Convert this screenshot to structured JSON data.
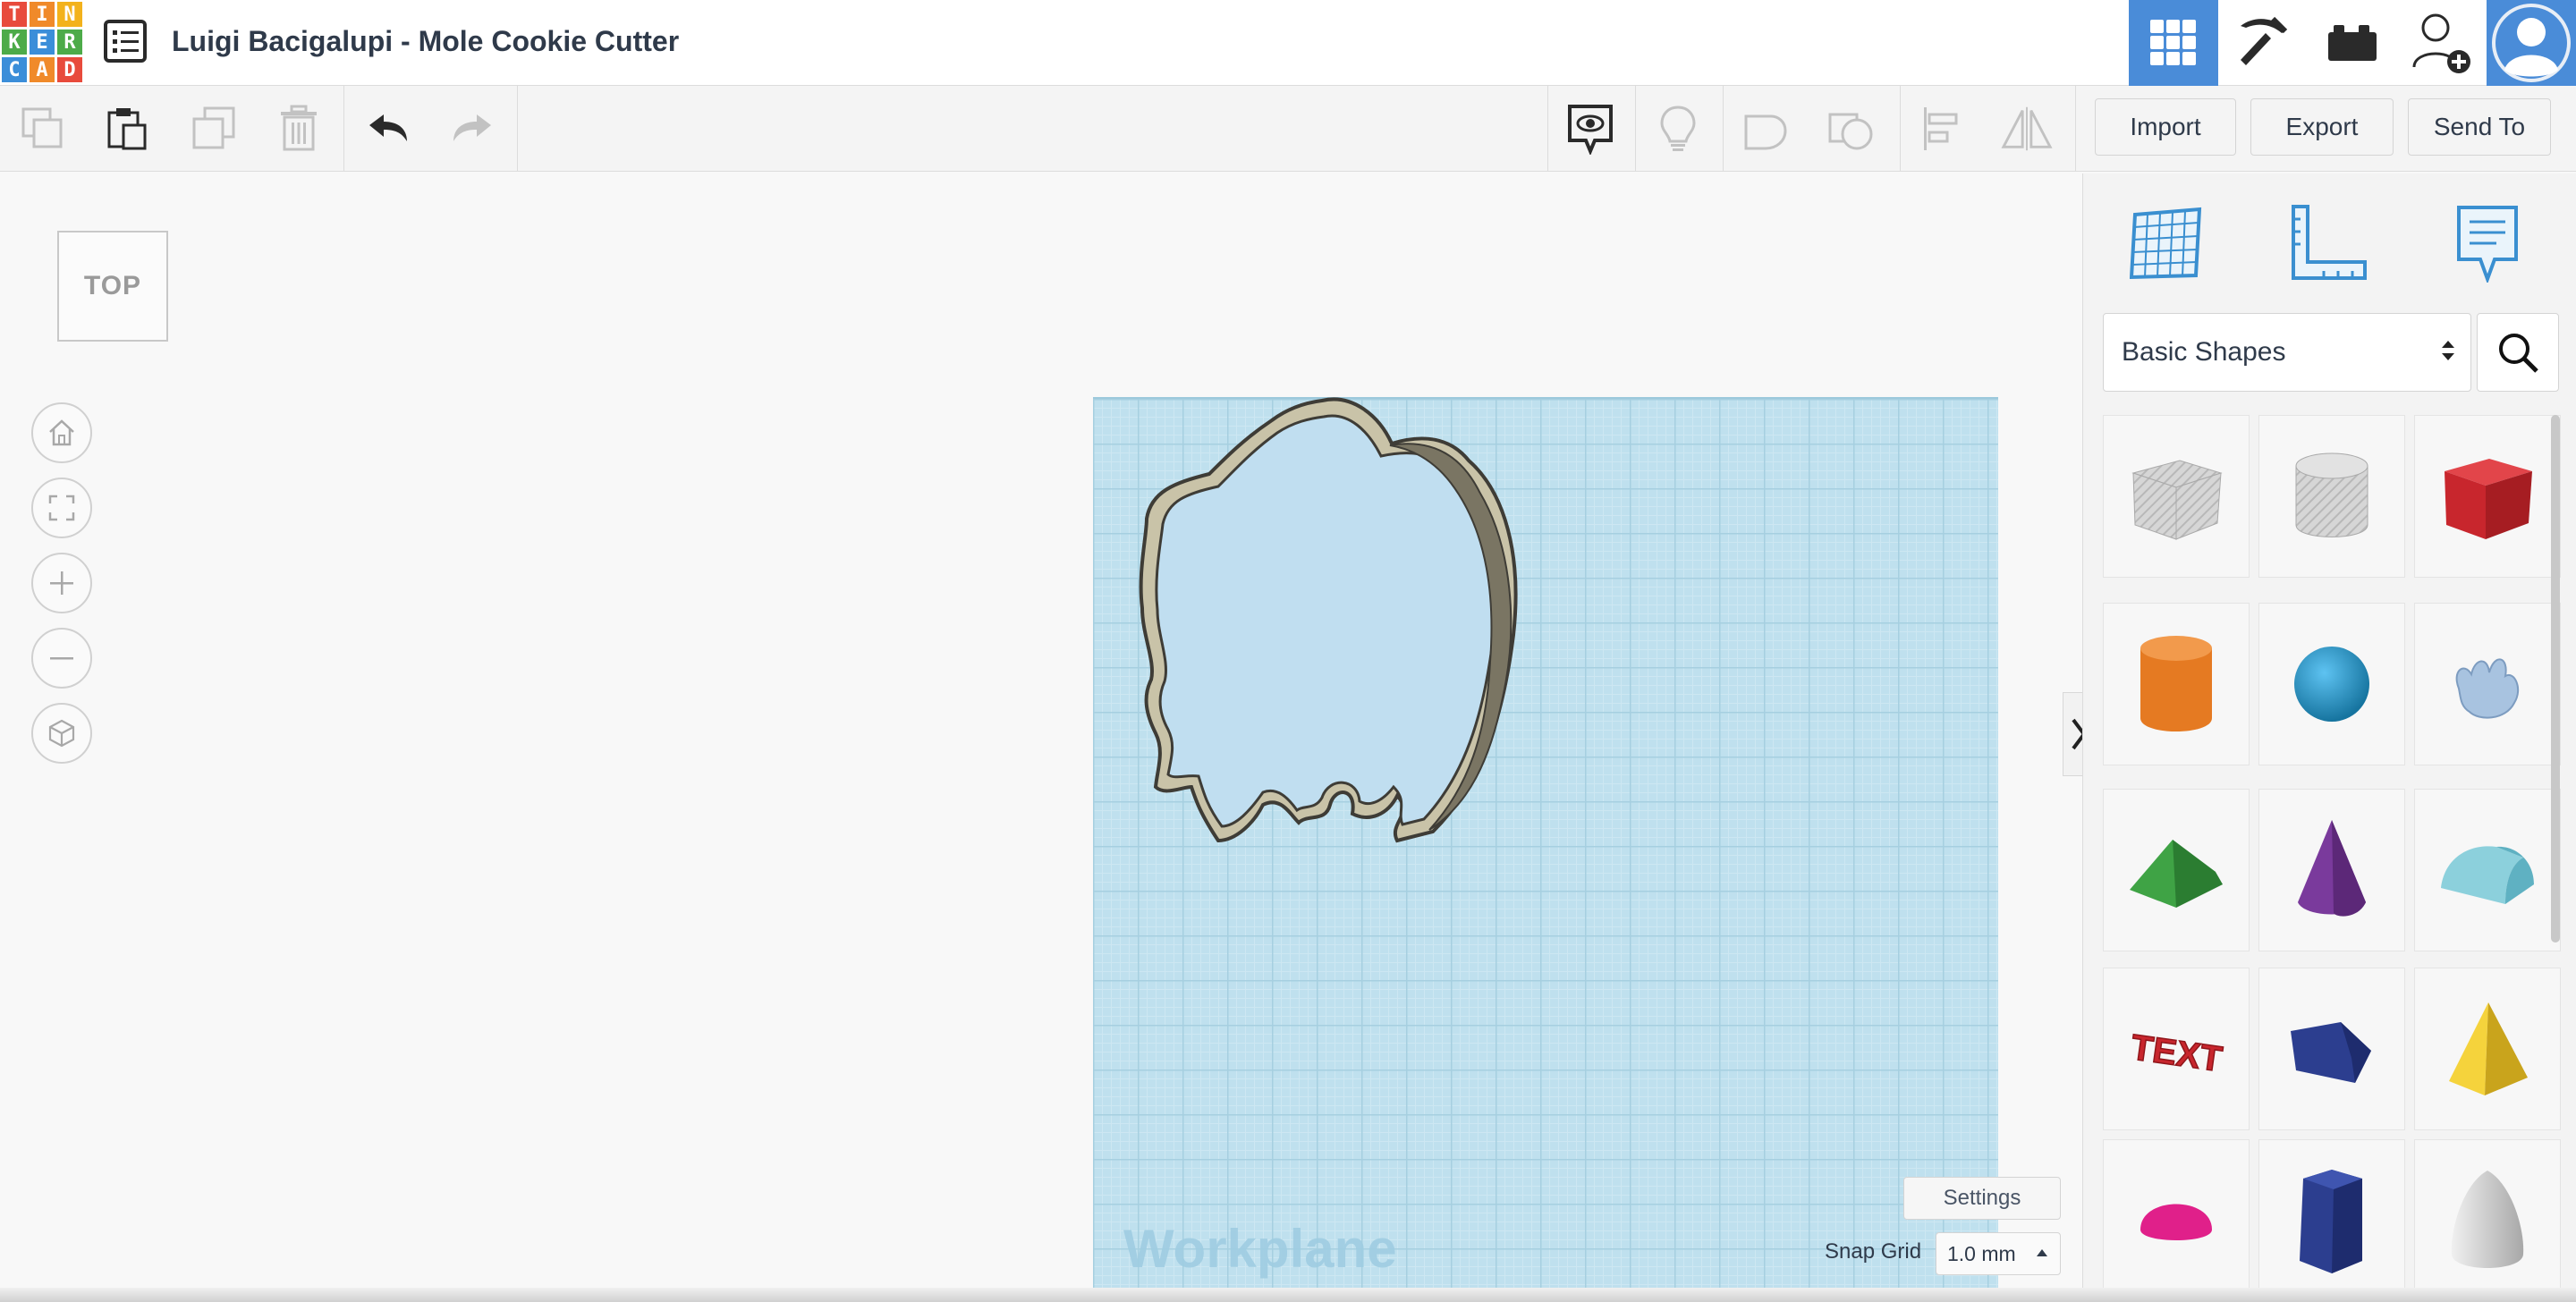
{
  "app": {
    "logo_letters": [
      "T",
      "I",
      "N",
      "K",
      "E",
      "R",
      "C",
      "A",
      "D"
    ],
    "logo_colors": [
      "#e84b3c",
      "#f08a2a",
      "#f3b21c",
      "#4dab49",
      "#3b8ed9",
      "#4dab49",
      "#3b8ed9",
      "#f08a2a",
      "#e84b3c"
    ],
    "title": "Luigi Bacigalupi - Mole Cookie Cutter"
  },
  "header": {
    "icons": [
      "3d-design-grid-icon",
      "pickaxe-icon",
      "bricks-icon",
      "add-user-icon",
      "user-avatar-icon"
    ],
    "active_color": "#4a8cd8"
  },
  "toolbar": {
    "left_icons": [
      "copy-icon",
      "paste-icon",
      "duplicate-icon",
      "delete-icon",
      "undo-icon",
      "redo-icon"
    ],
    "right_icons": [
      "notes-visibility-icon",
      "light-bulb-icon",
      "group-icon",
      "ungroup-icon",
      "align-icon",
      "mirror-icon"
    ],
    "import_label": "Import",
    "export_label": "Export",
    "send_to_label": "Send To"
  },
  "viewport": {
    "view_cube_label": "TOP",
    "view_controls": [
      "home-view-icon",
      "fit-view-icon",
      "zoom-in-icon",
      "zoom-out-icon",
      "ortho-view-icon"
    ],
    "workplane_label": "Workplane",
    "settings_label": "Settings",
    "snap_grid_label": "Snap Grid",
    "snap_grid_value": "1.0 mm"
  },
  "panel": {
    "top_icons": [
      "workplane-grid-icon",
      "ruler-icon",
      "notes-icon"
    ],
    "category_value": "Basic Shapes",
    "shapes": [
      "box-hole-shape",
      "cylinder-hole-shape",
      "box-shape",
      "cylinder-shape",
      "sphere-shape",
      "scribble-shape",
      "roof-shape",
      "cone-shape",
      "round-roof-shape",
      "text-shape",
      "polygon-shape",
      "pyramid-shape",
      "half-sphere-shape",
      "hexagonal-prism-shape",
      "paraboloid-shape"
    ],
    "text_shape_label": "TEXT"
  }
}
